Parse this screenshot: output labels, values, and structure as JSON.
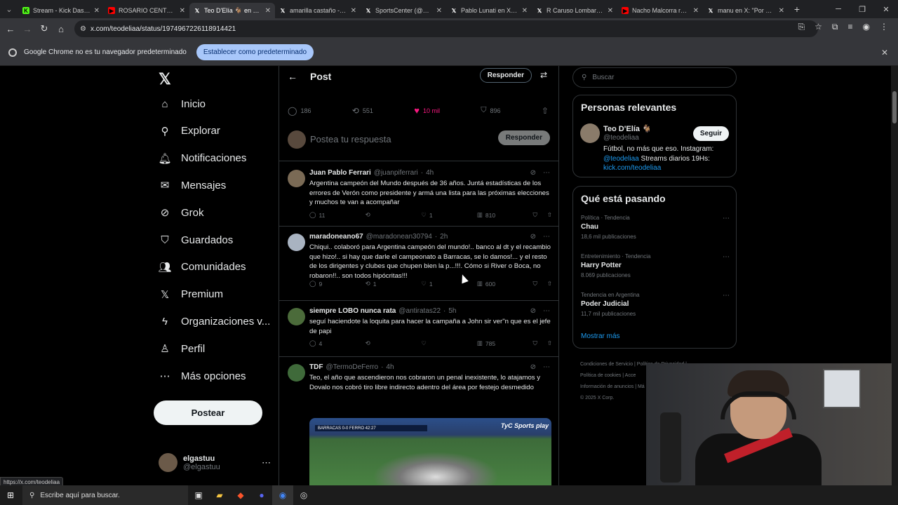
{
  "browser": {
    "tabs": [
      {
        "title": "Stream - Kick Dashb",
        "favicon": "kick",
        "color": "#53fc18"
      },
      {
        "title": "ROSARIO CENTRAL D",
        "favicon": "youtube",
        "color": "#ff0000"
      },
      {
        "title": "Teo D'Elía 🐐 en X: \"F",
        "favicon": "x",
        "color": "#ffffff",
        "active": true
      },
      {
        "title": "amarilla castaño - Bu",
        "favicon": "x",
        "color": "#ffffff"
      },
      {
        "title": "SportsCenter (@SC_E",
        "favicon": "x",
        "color": "#ffffff"
      },
      {
        "title": "Pablo Lunati en X: \"La",
        "favicon": "x",
        "color": "#ffffff"
      },
      {
        "title": "R Caruso Lombardi e",
        "favicon": "x",
        "color": "#ffffff"
      },
      {
        "title": "Nacho Malcorra resp",
        "favicon": "youtube",
        "color": "#ff0000"
      },
      {
        "title": "manu en X: \"Por qué",
        "favicon": "x",
        "color": "#ffffff"
      }
    ],
    "url": "x.com/teodeliaa/status/1974967226118914421",
    "infobar_message": "Google Chrome no es tu navegador predeterminado",
    "infobar_button": "Establecer como predeterminado",
    "status_url": "https://x.com/teodeliaa"
  },
  "sidebar": {
    "logo": "𝕏",
    "items": [
      {
        "label": "Inicio",
        "icon": "home-icon",
        "glyph": "⌂"
      },
      {
        "label": "Explorar",
        "icon": "search-icon",
        "glyph": "⚲"
      },
      {
        "label": "Notificaciones",
        "icon": "bell-icon",
        "glyph": "🔔︎"
      },
      {
        "label": "Mensajes",
        "icon": "mail-icon",
        "glyph": "✉"
      },
      {
        "label": "Grok",
        "icon": "grok-icon",
        "glyph": "⊘"
      },
      {
        "label": "Guardados",
        "icon": "bookmark-icon",
        "glyph": "⛉"
      },
      {
        "label": "Comunidades",
        "icon": "people-icon",
        "glyph": "👥︎"
      },
      {
        "label": "Premium",
        "icon": "x-icon",
        "glyph": "𝕏"
      },
      {
        "label": "Organizaciones v...",
        "icon": "lightning-icon",
        "glyph": "ϟ"
      },
      {
        "label": "Perfil",
        "icon": "person-icon",
        "glyph": "♙"
      },
      {
        "label": "Más opciones",
        "icon": "more-circle-icon",
        "glyph": "⋯"
      }
    ],
    "post_button": "Postear",
    "account": {
      "name": "elgastuu",
      "handle": "@elgastuu"
    }
  },
  "main": {
    "header_title": "Post",
    "reply_button": "Responder",
    "post_actions": {
      "replies": "186",
      "reposts": "551",
      "likes": "10 mil",
      "bookmarks": "896"
    },
    "reply_placeholder": "Postea tu respuesta",
    "reply_submit": "Responder",
    "tweets": [
      {
        "name": "Juan Pablo Ferrari",
        "handle": "@juanpiferrari",
        "time": "4h",
        "text": "Argentina campeón del Mundo después de 36 años. Juntá estadísticas de los errores de Verón como presidente y armá una lista para las próximas elecciones y muchos te van a acompañar",
        "replies": "11",
        "reposts": "",
        "likes": "1",
        "views": "810",
        "avatar_color": "#7a6a55"
      },
      {
        "name": "maradoneano67",
        "handle": "@maradonean30794",
        "time": "2h",
        "text": "Chiqui.. colaboró para Argentina campeón del mundo!.. banco al dt y el recambio que hizo!.. si hay que darle el campeonato a Barracas, se lo damos!... y el resto de los dirigentes y clubes que chupen bien la p...!!!. Cómo si River o Boca, no robaron!!.. son todos hipócritas!!!",
        "replies": "9",
        "reposts": "1",
        "likes": "1",
        "views": "600",
        "avatar_color": "#a9b3c1"
      },
      {
        "name": "siempre LOBO nunca rata",
        "handle": "@antiratas22",
        "time": "5h",
        "text": "seguí haciendote la loquita para hacer la campaña a John sir ver\"n que es el jefe de papi",
        "replies": "4",
        "reposts": "",
        "likes": "",
        "views": "785",
        "avatar_color": "#4b6b3a"
      },
      {
        "name": "TDF",
        "handle": "@TermoDeFerro",
        "time": "4h",
        "text": "Teo, el año que ascendieron nos cobraron un penal inexistente, lo atajamos y Dovalo nos cobró tiro libre indirecto adentro del área por festejo desmedido",
        "media_brand": "TyC Sports play",
        "media_score": "BARRACAS  0-0  FERRO   42:27",
        "avatar_color": "#3f6a3a"
      }
    ]
  },
  "right": {
    "search_placeholder": "Buscar",
    "relevant_title": "Personas relevantes",
    "person": {
      "name": "Teo D'Elía 🐐",
      "handle": "@teodeliaa",
      "follow": "Seguir",
      "bio_prefix": "Fútbol, no más que eso. Instagram:",
      "bio_link1": "@teodeliaa",
      "bio_middle": " Streams diarios 19Hs:",
      "bio_link2": "kick.com/teodeliaa"
    },
    "trending_title": "Qué está pasando",
    "trends": [
      {
        "context": "Política · Tendencia",
        "topic": "Chau",
        "count": "18,6 mil publicaciones"
      },
      {
        "context": "Entretenimiento · Tendencia",
        "topic": "Harry Potter",
        "count": "8.069 publicaciones"
      },
      {
        "context": "Tendencia en Argentina",
        "topic": "Poder Judicial",
        "count": "11,7 mil publicaciones"
      }
    ],
    "show_more": "Mostrar más",
    "footer": [
      "Condiciones de Servicio  |  Política de Privacidad  |",
      "Política de cookies  |  Acce",
      "Información de anuncios  |  Má",
      "© 2025 X Corp."
    ]
  },
  "taskbar": {
    "search_placeholder": "Escribe aquí para buscar."
  }
}
